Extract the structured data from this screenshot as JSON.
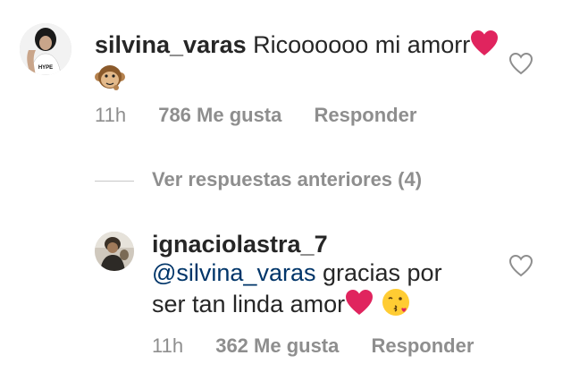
{
  "comments": [
    {
      "username": "silvina_varas",
      "text": "Ricoooooo mi amorr",
      "time": "11h",
      "likes": "786 Me gusta",
      "reply": "Responder"
    }
  ],
  "view_replies": "Ver respuestas anteriores (4)",
  "replies": [
    {
      "username": "ignaciolastra_7",
      "mention": "@silvina_varas",
      "text_line1": "gracias por",
      "text_line2": "ser tan linda amor",
      "time": "11h",
      "likes": "362 Me gusta",
      "reply": "Responder"
    }
  ],
  "icons": {
    "like": "heart-outline-icon",
    "emoji1": "red-heart-emoji",
    "emoji2": "monkey-emoji",
    "emoji3": "kissing-face-emoji"
  },
  "colors": {
    "text": "#262626",
    "meta": "#8e8e8e",
    "mention": "#003569",
    "heart_emoji": "#e0245e"
  }
}
